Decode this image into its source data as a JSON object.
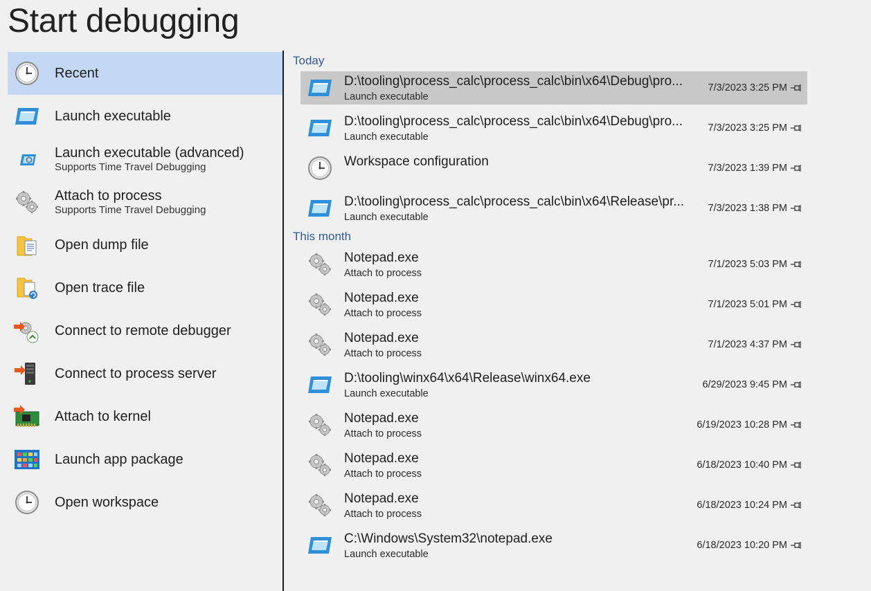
{
  "page": {
    "title": "Start debugging"
  },
  "nav": {
    "items": [
      {
        "label": "Recent",
        "sub": "",
        "icon": "clock-icon",
        "selected": true
      },
      {
        "label": "Launch executable",
        "sub": "",
        "icon": "window-icon"
      },
      {
        "label": "Launch executable (advanced)",
        "sub": "Supports Time Travel Debugging",
        "icon": "window-gear-icon"
      },
      {
        "label": "Attach to process",
        "sub": "Supports Time Travel Debugging",
        "icon": "gears-icon"
      },
      {
        "label": "Open dump file",
        "sub": "",
        "icon": "folder-document-icon"
      },
      {
        "label": "Open trace file",
        "sub": "",
        "icon": "folder-trace-icon"
      },
      {
        "label": "Connect to remote debugger",
        "sub": "",
        "icon": "remote-debugger-icon"
      },
      {
        "label": "Connect to process server",
        "sub": "",
        "icon": "server-icon"
      },
      {
        "label": "Attach to kernel",
        "sub": "",
        "icon": "circuit-board-icon"
      },
      {
        "label": "Launch app package",
        "sub": "",
        "icon": "app-package-icon"
      },
      {
        "label": "Open workspace",
        "sub": "",
        "icon": "clock-icon"
      }
    ]
  },
  "recent": {
    "sections": [
      {
        "header": "Today",
        "items": [
          {
            "title": "D:\\tooling\\process_calc\\process_calc\\bin\\x64\\Debug\\pro...",
            "sub": "Launch executable",
            "date": "7/3/2023 3:25 PM",
            "icon": "window-icon",
            "selected": true
          },
          {
            "title": "D:\\tooling\\process_calc\\process_calc\\bin\\x64\\Debug\\pro...",
            "sub": "Launch executable",
            "date": "7/3/2023 3:25 PM",
            "icon": "window-icon"
          },
          {
            "title": "Workspace configuration",
            "sub": "",
            "date": "7/3/2023 1:39 PM",
            "icon": "clock-icon"
          },
          {
            "title": "D:\\tooling\\process_calc\\process_calc\\bin\\x64\\Release\\pr...",
            "sub": "Launch executable",
            "date": "7/3/2023 1:38 PM",
            "icon": "window-icon"
          }
        ]
      },
      {
        "header": "This month",
        "items": [
          {
            "title": "Notepad.exe",
            "sub": "Attach to process",
            "date": "7/1/2023 5:03 PM",
            "icon": "gears-icon"
          },
          {
            "title": "Notepad.exe",
            "sub": "Attach to process",
            "date": "7/1/2023 5:01 PM",
            "icon": "gears-icon"
          },
          {
            "title": "Notepad.exe",
            "sub": "Attach to process",
            "date": "7/1/2023 4:37 PM",
            "icon": "gears-icon"
          },
          {
            "title": "D:\\tooling\\winx64\\x64\\Release\\winx64.exe",
            "sub": "Launch executable",
            "date": "6/29/2023 9:45 PM",
            "icon": "window-icon"
          },
          {
            "title": "Notepad.exe",
            "sub": "Attach to process",
            "date": "6/19/2023 10:28 PM",
            "icon": "gears-icon"
          },
          {
            "title": "Notepad.exe",
            "sub": "Attach to process",
            "date": "6/18/2023 10:40 PM",
            "icon": "gears-icon"
          },
          {
            "title": "Notepad.exe",
            "sub": "Attach to process",
            "date": "6/18/2023 10:24 PM",
            "icon": "gears-icon"
          },
          {
            "title": "C:\\Windows\\System32\\notepad.exe",
            "sub": "Launch executable",
            "date": "6/18/2023 10:20 PM",
            "icon": "window-icon"
          }
        ]
      }
    ]
  },
  "colors": {
    "background": "#f0f0f0",
    "selection_nav": "#c4d8f3",
    "selection_recent": "#c8c8c8",
    "section_header": "#2f5a97",
    "divider": "#1a1a1a"
  }
}
